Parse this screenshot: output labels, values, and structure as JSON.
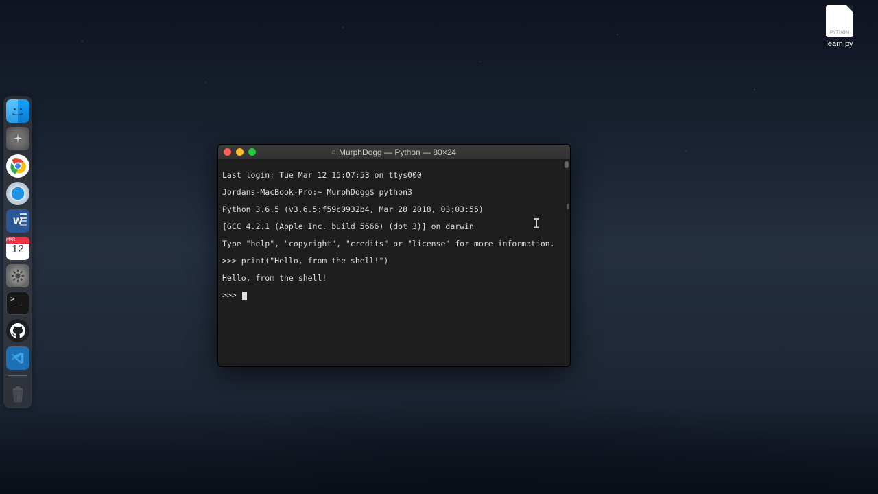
{
  "desktop": {
    "file": {
      "badge": "PYTHON",
      "label": "learn.py"
    }
  },
  "dock": {
    "items": [
      {
        "name": "finder"
      },
      {
        "name": "launchpad"
      },
      {
        "name": "chrome"
      },
      {
        "name": "safari"
      },
      {
        "name": "word",
        "text": "W"
      },
      {
        "name": "calendar",
        "month": "MAR",
        "day": "12"
      },
      {
        "name": "system-preferences"
      },
      {
        "name": "terminal"
      },
      {
        "name": "github"
      },
      {
        "name": "vscode"
      },
      {
        "name": "trash"
      }
    ]
  },
  "terminal": {
    "title": "MurphDogg — Python — 80×24",
    "lines": [
      "Last login: Tue Mar 12 15:07:53 on ttys000",
      "Jordans-MacBook-Pro:~ MurphDogg$ python3",
      "Python 3.6.5 (v3.6.5:f59c0932b4, Mar 28 2018, 03:03:55)",
      "[GCC 4.2.1 (Apple Inc. build 5666) (dot 3)] on darwin",
      "Type \"help\", \"copyright\", \"credits\" or \"license\" for more information.",
      ">>> print(\"Hello, from the shell!\")",
      "Hello, from the shell!",
      ">>> "
    ]
  }
}
